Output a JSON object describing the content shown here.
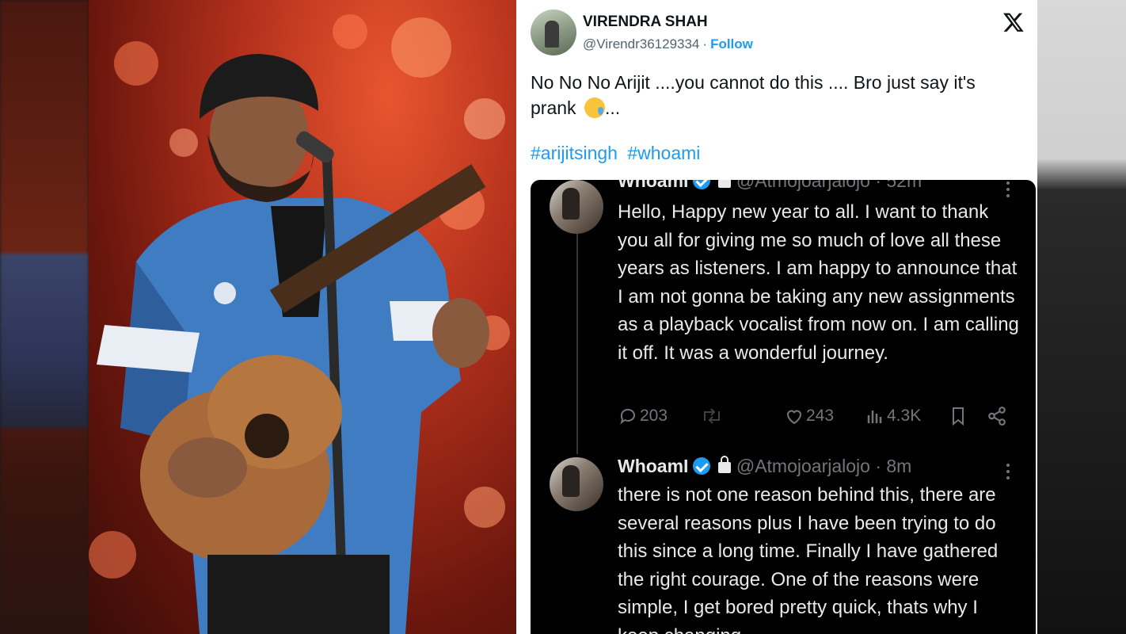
{
  "tweet": {
    "author": {
      "name": "VIRENDRA SHAH",
      "handle": "@Virendr36129334",
      "follow_label": "Follow"
    },
    "platform_icon": "x-logo-icon",
    "text": "No No No Arijit ....you cannot do this .... Bro just say it's prank",
    "text_tail": "...",
    "emoji": "face-holding-back-tears",
    "hashtags": [
      "#arijitsingh",
      "#whoami"
    ]
  },
  "embedded_screenshot": {
    "posts": [
      {
        "name": "WhoamI",
        "handle": "@Atmojoarjalojo",
        "time": "52m",
        "body": "Hello, Happy new year to all. I want to thank you all for giving me so much of love all these years as listeners. I am happy to announce that I am not gonna be taking any new assignments as a playback vocalist from now on. I am calling it off. It was a wonderful journey.",
        "stats": {
          "replies": "203",
          "likes": "243",
          "views": "4.3K"
        }
      },
      {
        "name": "WhoamI",
        "handle": "@Atmojoarjalojo",
        "time": "8m",
        "body": "there is not one reason behind this, there are several reasons plus I have been trying to do this since a long time. Finally I have gathered the right courage. One of the reasons were simple, I get bored pretty quick, thats why I keep changing"
      }
    ]
  },
  "colors": {
    "link": "#1d9bf0",
    "dark_bg": "#000000",
    "dark_text": "#e7e9ea",
    "muted": "#71767b"
  }
}
